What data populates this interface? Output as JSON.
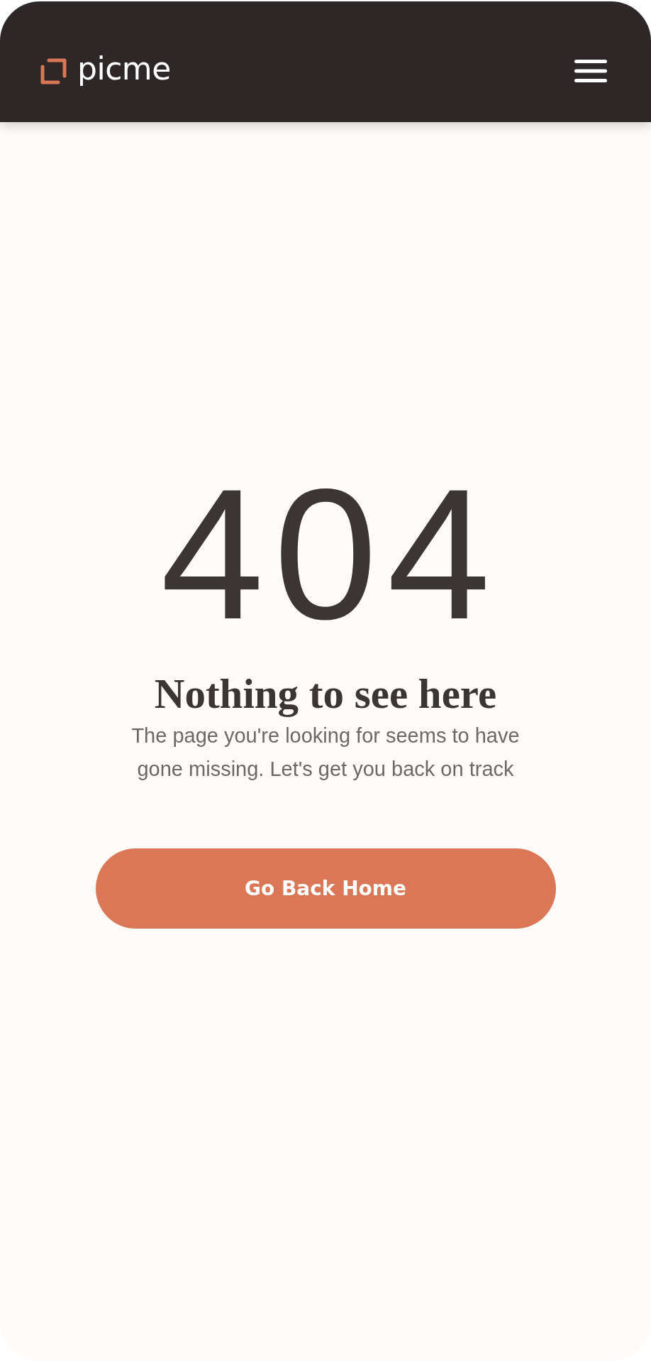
{
  "header": {
    "logo_text": "picme"
  },
  "error": {
    "code": "404",
    "title": "Nothing to see here",
    "message": "The page you're looking for seems to have gone missing. Let's get you back on track"
  },
  "button": {
    "label": "Go Back Home"
  }
}
